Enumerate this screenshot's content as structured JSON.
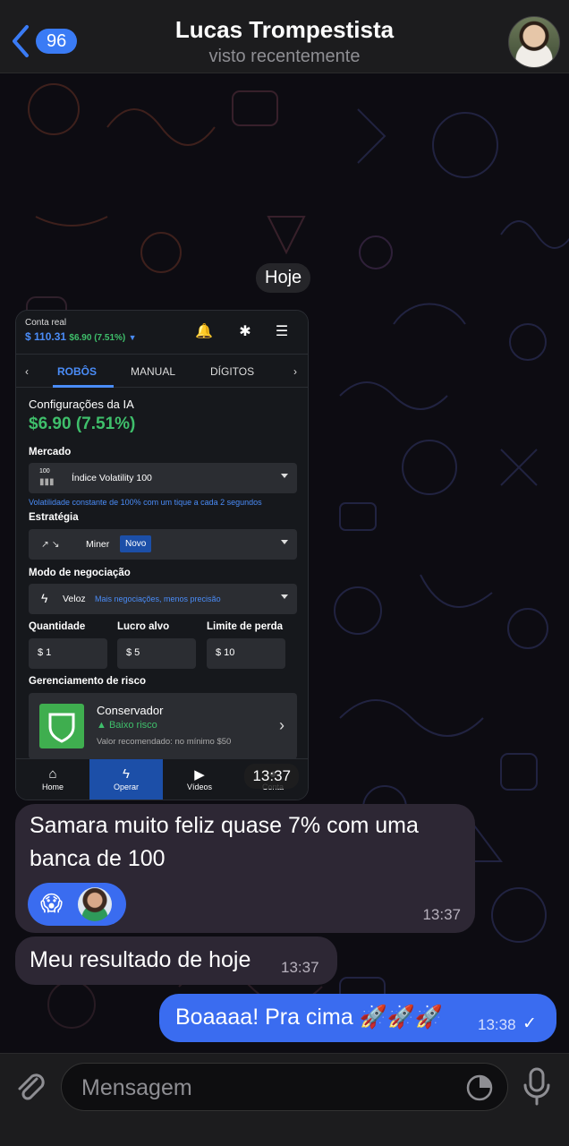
{
  "header": {
    "back_count": "96",
    "contact_name": "Lucas Trompestista",
    "status": "visto recentemente"
  },
  "date_separator": "Hoje",
  "screenshot": {
    "account_label": "Conta real",
    "balance": "$ 110.31",
    "balance_change": "$6.90 (7.51%)",
    "tabs": [
      "ROBÔS",
      "MANUAL",
      "DÍGITOS"
    ],
    "section_title": "Configurações da IA",
    "profit": "$6.90 (7.51%)",
    "market_label": "Mercado",
    "market_value": "Índice Volatility 100",
    "market_icon_badge": "100",
    "market_hint": "Volatilidade constante de 100% com um tique a cada 2 segundos",
    "strategy_label": "Estratégia",
    "strategy_value": "Miner",
    "strategy_badge": "Novo",
    "mode_label": "Modo de negociação",
    "mode_value": "Veloz",
    "mode_hint": "Mais negociações, menos precisão",
    "quantity_label": "Quantidade",
    "quantity_value": "$   1",
    "target_label": "Lucro alvo",
    "target_value": "$   5",
    "loss_label": "Limite de perda",
    "loss_value": "$   10",
    "risk_label": "Gerenciamento de risco",
    "risk_title": "Conservador",
    "risk_level": "Baixo risco",
    "risk_note": "Valor recomendado: no mínimo $50",
    "nav": [
      "Home",
      "Operar",
      "Vídeos",
      "Conta"
    ],
    "time": "13:37"
  },
  "messages": [
    {
      "text": "Samara muito feliz quase 7% com uma banca de 100",
      "time": "13:37",
      "reaction": "😱"
    },
    {
      "text": "Meu resultado de hoje",
      "time": "13:37"
    },
    {
      "text": "Boaaaa! Pra cima 🚀🚀🚀",
      "time": "13:38",
      "status": "✓"
    }
  ],
  "composer": {
    "placeholder": "Mensagem"
  },
  "colors": {
    "accent": "#3a6cf0",
    "incoming_bubble": "#2d2734",
    "profit_green": "#3fbf6b"
  }
}
